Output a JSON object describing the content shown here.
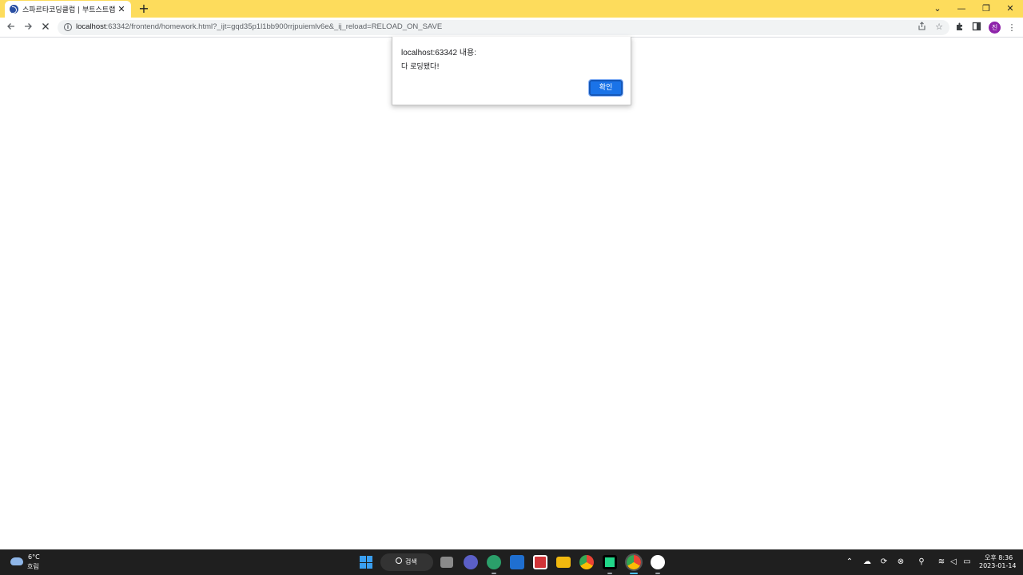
{
  "browser": {
    "tab_title": "스파르타코딩클럽 | 부트스트랩",
    "tab_close": "✕",
    "new_tab": "+",
    "url_host": "localhost",
    "url_rest": ":63342/frontend/homework.html?_ijt=gqd35p1l1bb900rrjpuiemlv6e&_ij_reload=RELOAD_ON_SAVE",
    "profile_initial": "진",
    "window_controls": {
      "collapse": "⌄",
      "minimize": "—",
      "restore": "❐",
      "close": "✕"
    }
  },
  "dialog": {
    "origin": "localhost:63342 내용:",
    "message": "다 로딩됐다!",
    "ok_label": "확인"
  },
  "taskbar": {
    "weather_temp": "6°C",
    "weather_desc": "흐림",
    "search_label": "검색",
    "clock_time": "오후 8:36",
    "clock_date": "2023-01-14"
  },
  "colors": {
    "tabstrip": "#fddc5c",
    "accent": "#1a73e8",
    "taskbar": "#1f1f1f"
  }
}
